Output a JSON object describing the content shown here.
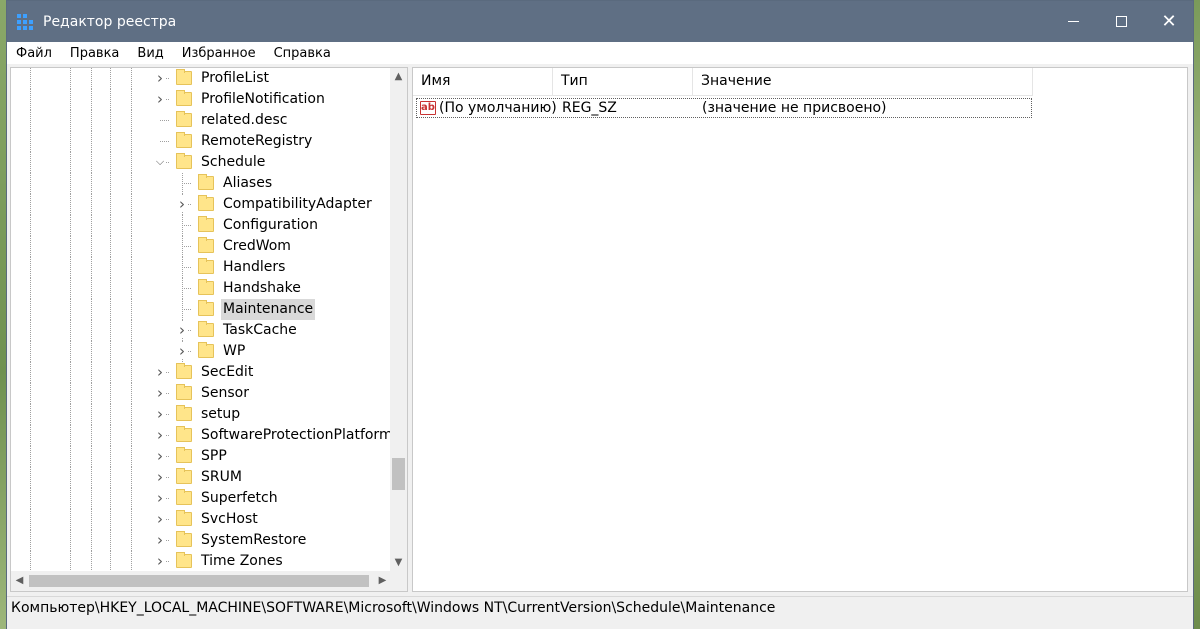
{
  "window": {
    "title": "Редактор реестра"
  },
  "menu": [
    "Файл",
    "Правка",
    "Вид",
    "Избранное",
    "Справка"
  ],
  "tree": [
    {
      "label": "ProfileList",
      "expander": "›",
      "indent": 1
    },
    {
      "label": "ProfileNotification",
      "expander": "›",
      "indent": 1
    },
    {
      "label": "related.desc",
      "expander": "",
      "indent": 1
    },
    {
      "label": "RemoteRegistry",
      "expander": "",
      "indent": 1
    },
    {
      "label": "Schedule",
      "expander": "⌄",
      "indent": 1
    },
    {
      "label": "Aliases",
      "expander": "",
      "indent": 2
    },
    {
      "label": "CompatibilityAdapter",
      "expander": "›",
      "indent": 2
    },
    {
      "label": "Configuration",
      "expander": "",
      "indent": 2
    },
    {
      "label": "CredWom",
      "expander": "",
      "indent": 2
    },
    {
      "label": "Handlers",
      "expander": "",
      "indent": 2
    },
    {
      "label": "Handshake",
      "expander": "",
      "indent": 2
    },
    {
      "label": "Maintenance",
      "expander": "",
      "indent": 2,
      "selected": true
    },
    {
      "label": "TaskCache",
      "expander": "›",
      "indent": 2
    },
    {
      "label": "WP",
      "expander": "›",
      "indent": 2
    },
    {
      "label": "SecEdit",
      "expander": "›",
      "indent": 1
    },
    {
      "label": "Sensor",
      "expander": "›",
      "indent": 1
    },
    {
      "label": "setup",
      "expander": "›",
      "indent": 1
    },
    {
      "label": "SoftwareProtectionPlatform",
      "expander": "›",
      "indent": 1
    },
    {
      "label": "SPP",
      "expander": "›",
      "indent": 1
    },
    {
      "label": "SRUM",
      "expander": "›",
      "indent": 1
    },
    {
      "label": "Superfetch",
      "expander": "›",
      "indent": 1
    },
    {
      "label": "SvcHost",
      "expander": "›",
      "indent": 1
    },
    {
      "label": "SystemRestore",
      "expander": "›",
      "indent": 1
    },
    {
      "label": "Time Zones",
      "expander": "›",
      "indent": 1
    }
  ],
  "list": {
    "columns": [
      "Имя",
      "Тип",
      "Значение"
    ],
    "rows": [
      {
        "name": "(По умолчанию)",
        "type": "REG_SZ",
        "value": "(значение не присвоено)",
        "icon": "ab-string-icon",
        "icon_text": "ab"
      }
    ]
  },
  "status": {
    "path": "Компьютер\\HKEY_LOCAL_MACHINE\\SOFTWARE\\Microsoft\\Windows NT\\CurrentVersion\\Schedule\\Maintenance"
  }
}
